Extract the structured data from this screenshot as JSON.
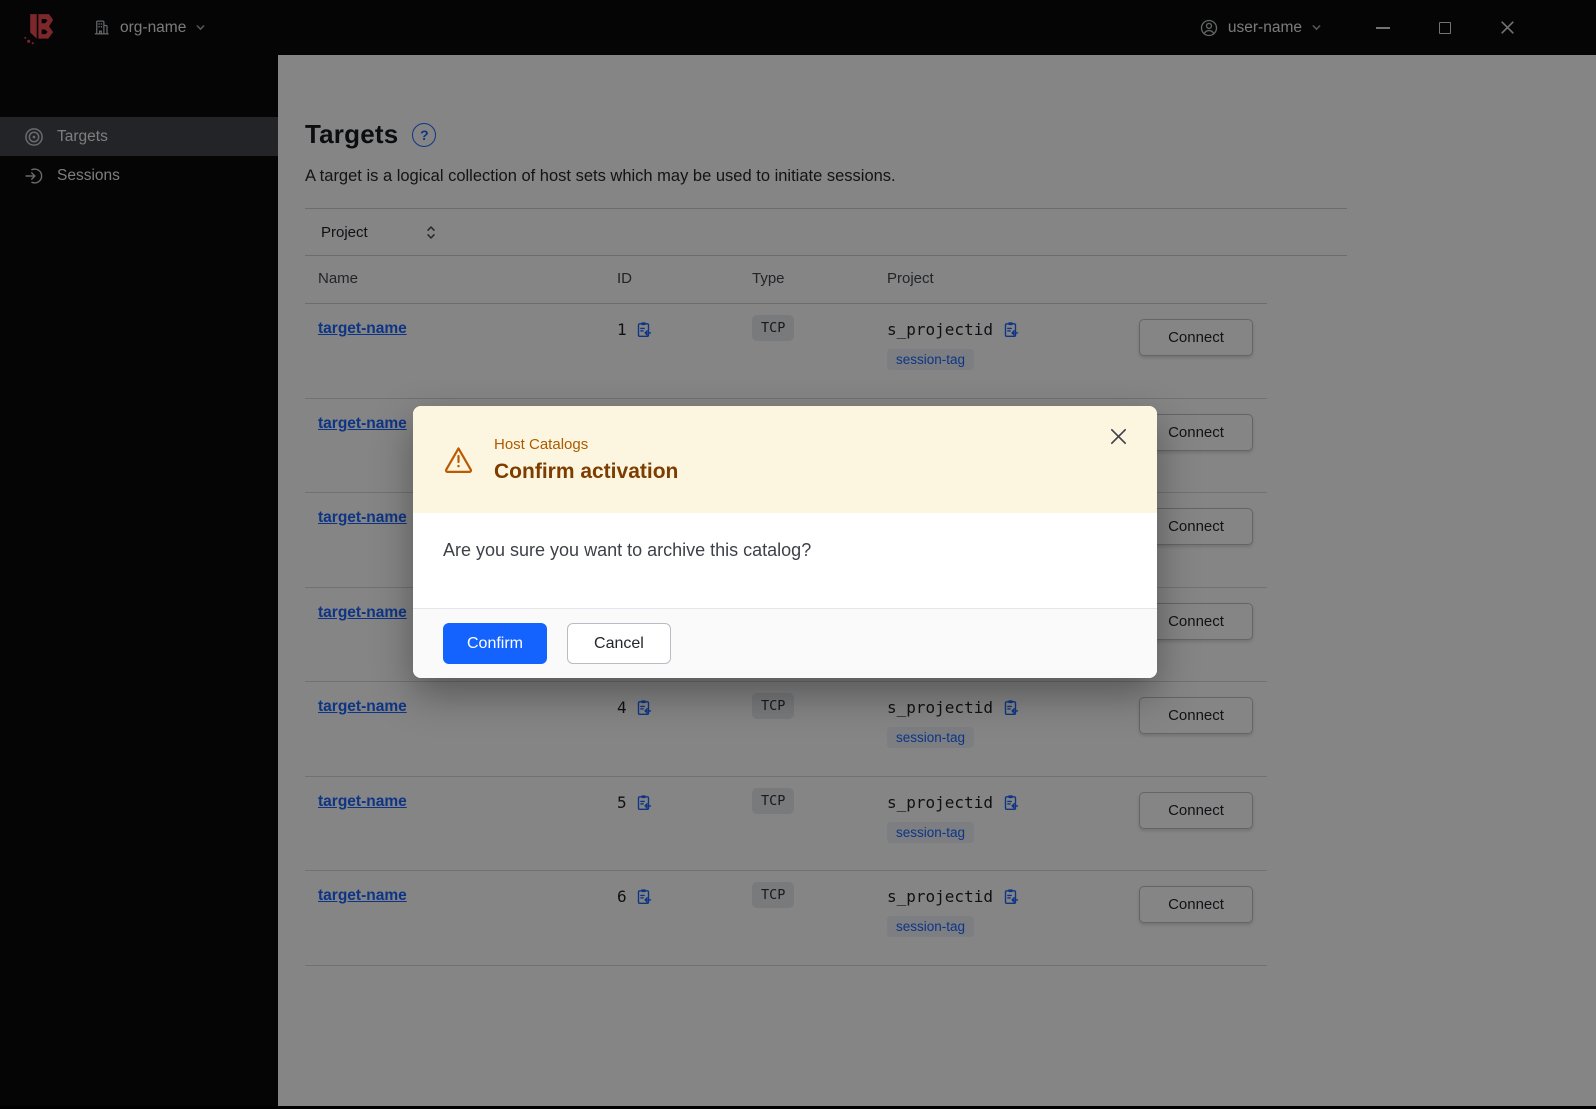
{
  "topbar": {
    "org_label": "org-name",
    "user_label": "user-name"
  },
  "sidebar": {
    "items": [
      {
        "label": "Targets",
        "icon": "targets-icon",
        "active": true
      },
      {
        "label": "Sessions",
        "icon": "sessions-icon",
        "active": false
      }
    ]
  },
  "page": {
    "title": "Targets",
    "description": "A target is a logical collection of host sets which may be used to initiate sessions."
  },
  "filter": {
    "label": "Project"
  },
  "table": {
    "headers": {
      "name": "Name",
      "id": "ID",
      "type": "Type",
      "project": "Project"
    },
    "rows": [
      {
        "name": "target-name",
        "id": "1",
        "type": "TCP",
        "project": "s_projectid",
        "session_tag": "session-tag",
        "connect": "Connect"
      },
      {
        "name": "target-name",
        "id": "",
        "type": "",
        "project": "",
        "session_tag": "",
        "connect": "Connect"
      },
      {
        "name": "target-name",
        "id": "",
        "type": "",
        "project": "",
        "session_tag": "",
        "connect": "Connect"
      },
      {
        "name": "target-name",
        "id": "",
        "type": "",
        "project": "",
        "session_tag": "",
        "connect": "Connect"
      },
      {
        "name": "target-name",
        "id": "4",
        "type": "TCP",
        "project": "s_projectid",
        "session_tag": "session-tag",
        "connect": "Connect"
      },
      {
        "name": "target-name",
        "id": "5",
        "type": "TCP",
        "project": "s_projectid",
        "session_tag": "session-tag",
        "connect": "Connect"
      },
      {
        "name": "target-name",
        "id": "6",
        "type": "TCP",
        "project": "s_projectid",
        "session_tag": "session-tag",
        "connect": "Connect"
      }
    ]
  },
  "modal": {
    "eyebrow": "Host Catalogs",
    "title": "Confirm activation",
    "message": "Are you sure you want to archive this catalog?",
    "confirm_label": "Confirm",
    "cancel_label": "Cancel"
  },
  "colors": {
    "accent_blue": "#1463FF",
    "link_blue": "#1C66FF",
    "brand_red": "#F24C53",
    "warning_icon": "#BB5A00",
    "warning_title": "#7E3D00",
    "warning_surface": "#FCF6E0",
    "chrome_black": "#0A0A0C"
  },
  "icons": {
    "boundary-logo": "angular-B-mark",
    "org-icon": "building",
    "user-icon": "person-circle",
    "chevron-down-icon": "v",
    "minimize-icon": "–",
    "maximize-icon": "□",
    "close-window-icon": "×",
    "targets-icon": "bullseye",
    "sessions-icon": "arrow-into-circle",
    "help-icon": "?",
    "sort-icon": "up-down-carets",
    "copy-icon": "clipboard-copy",
    "warning-icon": "alert-triangle",
    "close-icon": "×"
  }
}
